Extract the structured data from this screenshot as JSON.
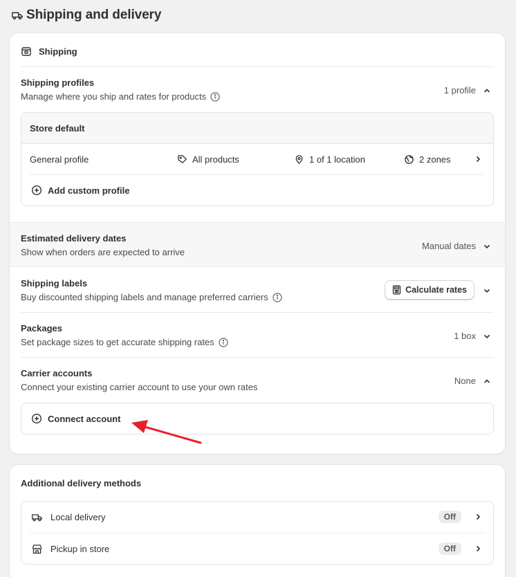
{
  "page": {
    "title": "Shipping and delivery"
  },
  "shipping_card": {
    "header": "Shipping",
    "profiles": {
      "title": "Shipping profiles",
      "description": "Manage where you ship and rates for products",
      "meta": "1 profile",
      "store_default": "Store default",
      "general": {
        "name": "General profile",
        "products": "All products",
        "locations": "1 of 1 location",
        "zones": "2 zones"
      },
      "add_custom": "Add custom profile"
    },
    "delivery_dates": {
      "title": "Estimated delivery dates",
      "description": "Show when orders are expected to arrive",
      "meta": "Manual dates"
    },
    "labels": {
      "title": "Shipping labels",
      "description": "Buy discounted shipping labels and manage preferred carriers",
      "button": "Calculate rates"
    },
    "packages": {
      "title": "Packages",
      "description": "Set package sizes to get accurate shipping rates",
      "meta": "1 box"
    },
    "carriers": {
      "title": "Carrier accounts",
      "description": "Connect your existing carrier account to use your own rates",
      "meta": "None",
      "connect": "Connect account"
    }
  },
  "additional_card": {
    "title": "Additional delivery methods",
    "methods": [
      {
        "label": "Local delivery",
        "status": "Off",
        "icon": "truck-icon"
      },
      {
        "label": "Pickup in store",
        "status": "Off",
        "icon": "store-icon"
      }
    ]
  },
  "colors": {
    "annotation_arrow": "#e8202a"
  }
}
